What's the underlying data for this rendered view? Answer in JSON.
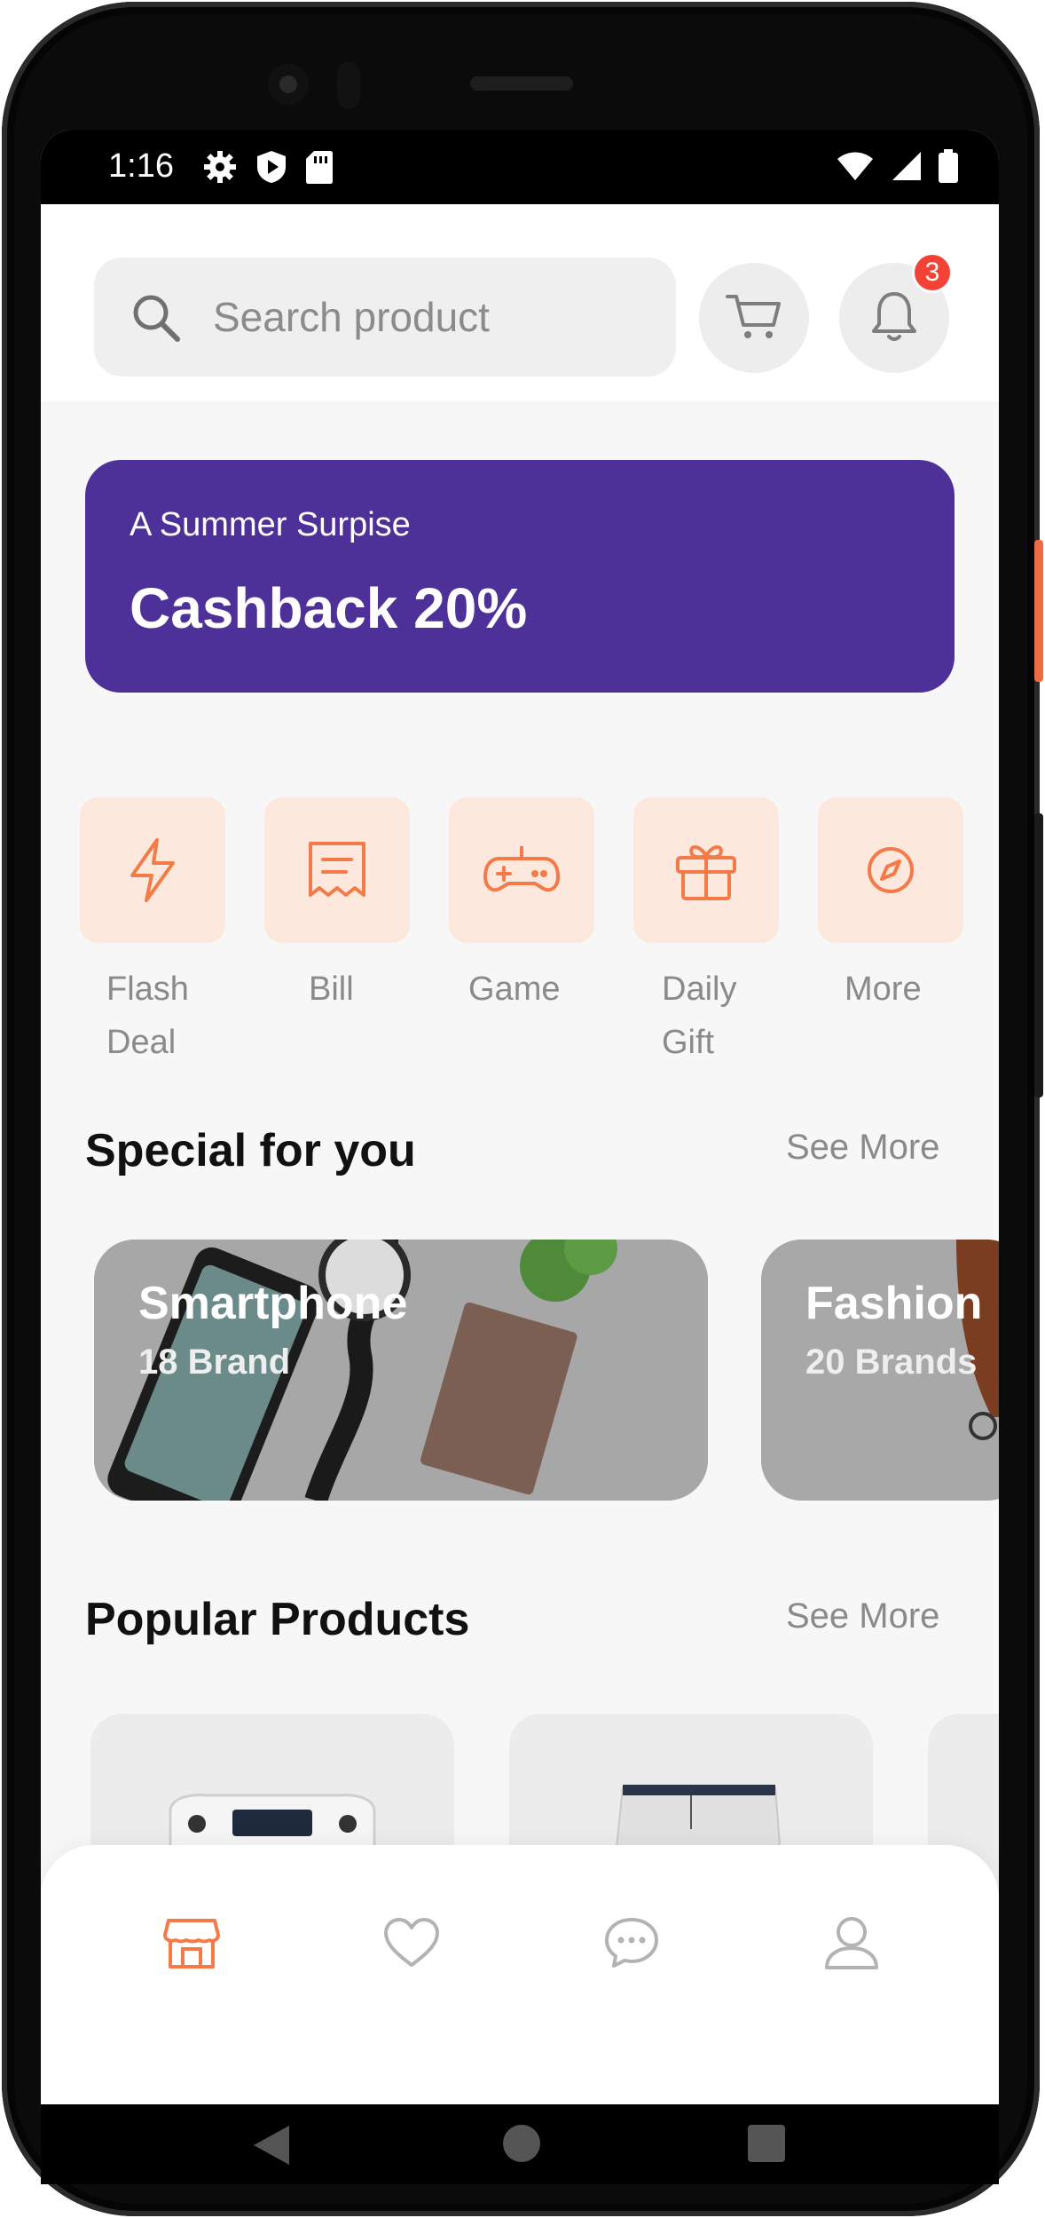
{
  "status_bar": {
    "time": "1:16",
    "left_icons": [
      "settings-icon",
      "shield-play-icon",
      "sd-card-icon"
    ],
    "right_icons": [
      "wifi-icon",
      "signal-icon",
      "battery-icon"
    ]
  },
  "header": {
    "search_placeholder": "Search product",
    "cart_icon": "cart-icon",
    "notifications": {
      "icon": "bell-icon",
      "badge_count": "3"
    }
  },
  "banner": {
    "subtitle": "A Summer Surpise",
    "title": "Cashback 20%",
    "color": "#4E3198"
  },
  "categories": [
    {
      "icon": "flash-icon",
      "label_line1": "Flash",
      "label_line2": "Deal"
    },
    {
      "icon": "bill-icon",
      "label_line1": "Bill",
      "label_line2": ""
    },
    {
      "icon": "game-icon",
      "label_line1": "Game",
      "label_line2": ""
    },
    {
      "icon": "gift-icon",
      "label_line1": "Daily",
      "label_line2": "Gift"
    },
    {
      "icon": "discover-icon",
      "label_line1": "More",
      "label_line2": ""
    }
  ],
  "special": {
    "title": "Special for you",
    "see_more": "See More",
    "cards": [
      {
        "name": "Smartphone",
        "count": "18 Brand"
      },
      {
        "name": "Fashion",
        "count": "20 Brands"
      }
    ]
  },
  "popular": {
    "title": "Popular Products",
    "see_more": "See More"
  },
  "bottom_nav": [
    {
      "icon": "shop-icon",
      "active": true
    },
    {
      "icon": "heart-icon",
      "active": false
    },
    {
      "icon": "chat-bubble-icon",
      "active": false
    },
    {
      "icon": "user-icon",
      "active": false
    }
  ],
  "colors": {
    "accent": "#F47A48",
    "accent_bg": "#FDE8DD",
    "badge": "#F44336"
  }
}
